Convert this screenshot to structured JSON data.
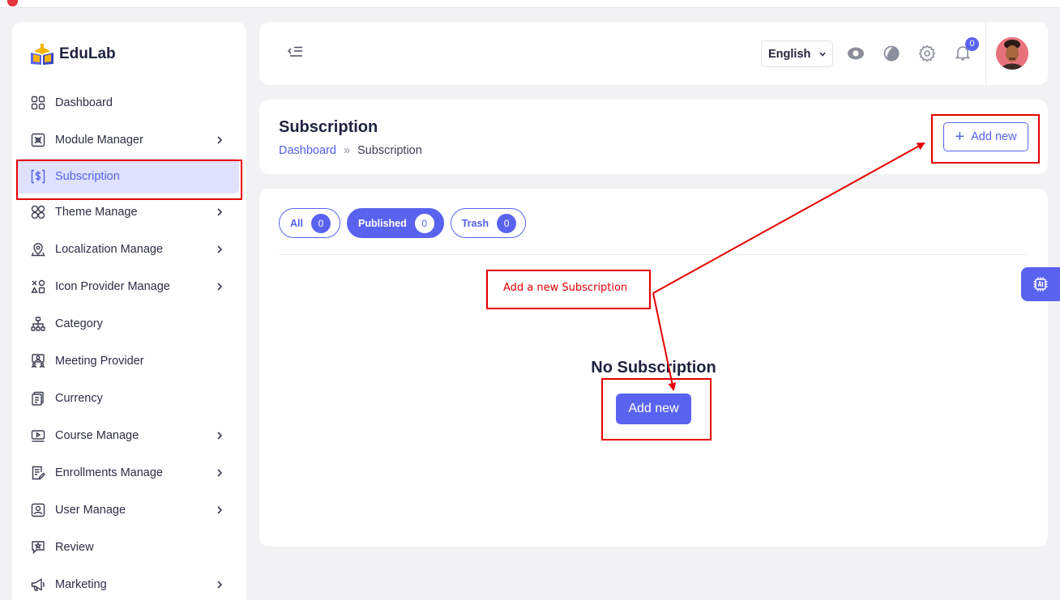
{
  "brand": {
    "name": "EduLab"
  },
  "sidebar": {
    "items": [
      {
        "label": "Dashboard",
        "icon": "grid-icon",
        "has_submenu": false,
        "active": false
      },
      {
        "label": "Module Manager",
        "icon": "module-icon",
        "has_submenu": true,
        "active": false
      },
      {
        "label": "Subscription",
        "icon": "dollar-icon",
        "has_submenu": false,
        "active": true
      },
      {
        "label": "Theme Manage",
        "icon": "clover-icon",
        "has_submenu": true,
        "active": false
      },
      {
        "label": "Localization Manage",
        "icon": "location-icon",
        "has_submenu": true,
        "active": false
      },
      {
        "label": "Icon Provider Manage",
        "icon": "shapes-icon",
        "has_submenu": true,
        "active": false
      },
      {
        "label": "Category",
        "icon": "hierarchy-icon",
        "has_submenu": false,
        "active": false
      },
      {
        "label": "Meeting Provider",
        "icon": "meeting-icon",
        "has_submenu": false,
        "active": false
      },
      {
        "label": "Currency",
        "icon": "currency-icon",
        "has_submenu": false,
        "active": false
      },
      {
        "label": "Course Manage",
        "icon": "video-icon",
        "has_submenu": true,
        "active": false
      },
      {
        "label": "Enrollments Manage",
        "icon": "document-edit-icon",
        "has_submenu": true,
        "active": false
      },
      {
        "label": "User Manage",
        "icon": "user-card-icon",
        "has_submenu": true,
        "active": false
      },
      {
        "label": "Review",
        "icon": "star-chat-icon",
        "has_submenu": false,
        "active": false
      },
      {
        "label": "Marketing",
        "icon": "megaphone-icon",
        "has_submenu": true,
        "active": false
      }
    ]
  },
  "header": {
    "language": "English",
    "notification_count": "0"
  },
  "page": {
    "title": "Subscription",
    "breadcrumb": {
      "home": "Dashboard",
      "separator": "»",
      "current": "Subscription"
    },
    "add_button": "Add new"
  },
  "tabs": [
    {
      "label": "All",
      "count": "0"
    },
    {
      "label": "Published",
      "count": "0"
    },
    {
      "label": "Trash",
      "count": "0"
    }
  ],
  "empty_state": {
    "title": "No Subscription",
    "button": "Add new"
  },
  "annotation": {
    "label": "Add a new Subscription"
  },
  "colors": {
    "accent": "#5a63f0",
    "annotation": "#e60000",
    "active_bg": "#dfe1ff"
  }
}
